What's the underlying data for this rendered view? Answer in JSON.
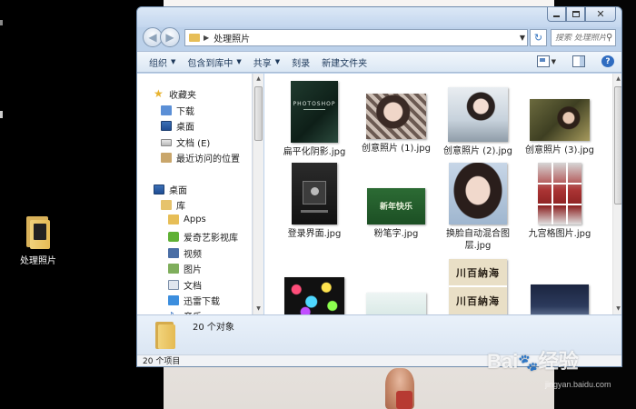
{
  "desktop": {
    "icon_label": "处理照片"
  },
  "window": {
    "address": {
      "path": "处理照片",
      "search_placeholder": "搜索 处理照片"
    },
    "toolbar": {
      "organize": "组织",
      "include_in_library": "包含到库中",
      "share": "共享",
      "burn": "刻录",
      "new_folder": "新建文件夹"
    },
    "nav": {
      "favorites": "收藏夹",
      "downloads": "下载",
      "desktop_fav": "桌面",
      "docs_e": "文档 (E)",
      "recent": "最近访问的位置",
      "desktop": "桌面",
      "libraries": "库",
      "apps": "Apps",
      "iqiyi": "爱奇艺影视库",
      "video": "视频",
      "pictures": "图片",
      "documents": "文档",
      "xunlei": "迅雷下载",
      "music": "音乐"
    },
    "files": [
      {
        "name": "扁平化阴影.jpg",
        "thumb_text": "PHOTOSHOP"
      },
      {
        "name": "创意照片 (1).jpg"
      },
      {
        "name": "创意照片 (2).jpg"
      },
      {
        "name": "创意照片 (3).jpg"
      },
      {
        "name": "登录界面.jpg"
      },
      {
        "name": "粉笔字.jpg",
        "thumb_text": "新年快乐"
      },
      {
        "name": "换脸自动混合图层.jpg"
      },
      {
        "name": "九宫格图片.jpg"
      },
      {
        "name": ""
      },
      {
        "name": ""
      },
      {
        "name": "",
        "thumb_text_top": "川百納海",
        "thumb_text_bottom": "川百納海"
      },
      {
        "name": ""
      }
    ],
    "details_pane": {
      "count": "20 个对象"
    },
    "status_bar": {
      "text": "20 个项目"
    }
  },
  "watermark": {
    "text": "Bai",
    "paw": "🐾",
    "text2": "经验",
    "sub": "jingyan.baidu.com"
  }
}
